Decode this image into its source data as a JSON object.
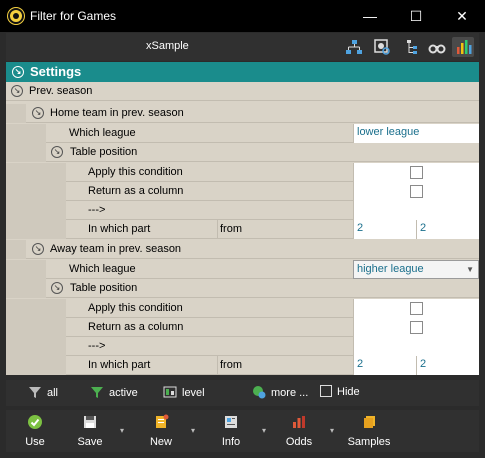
{
  "window": {
    "title": "Filter for Games",
    "minimize": "—",
    "maximize": "☐",
    "close": "✕"
  },
  "toolbar": {
    "sample_label": "xSample",
    "icons": [
      "hierarchy-icon",
      "settings-search-icon",
      "tree-icon",
      "binoculars-icon",
      "bar-chart-icon"
    ]
  },
  "settings": {
    "header": "Settings",
    "prev_season": "Prev. season",
    "home": {
      "title": "Home team in prev. season",
      "which_league_label": "Which league",
      "which_league_value": "lower league",
      "table_position": "Table position",
      "apply": "Apply this condition",
      "return_col": "Return as a column",
      "arrow": "--->",
      "in_which_part": "In which part",
      "from": "from",
      "val1": "2",
      "val2": "2"
    },
    "away": {
      "title": "Away team in prev. season",
      "which_league_label": "Which league",
      "which_league_value": "higher league",
      "table_position": "Table position",
      "apply": "Apply this condition",
      "return_col": "Return as a column",
      "arrow": "--->",
      "in_which_part": "In which part",
      "from": "from",
      "val1": "2",
      "val2": "2"
    }
  },
  "filterbar": {
    "all": "all",
    "active": "active",
    "level": "level",
    "more": "more ...",
    "hide": "Hide"
  },
  "bottombar": {
    "use": "Use",
    "save": "Save",
    "new": "New",
    "info": "Info",
    "odds": "Odds",
    "samples": "Samples"
  },
  "colors": {
    "accent": "#1a8c8c",
    "value_text": "#1a6f8c",
    "panel_bg": "#d9d3c7"
  }
}
